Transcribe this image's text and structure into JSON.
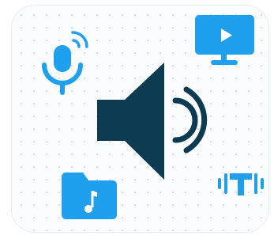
{
  "illustration": {
    "icons": [
      "microphone-icon",
      "monitor-play-icon",
      "speaker-volume-icon",
      "music-folder-icon",
      "text-to-speech-icon"
    ],
    "colors": {
      "primary": "#0d3b52",
      "accent": "#1ea0ee",
      "background": "#fbfcfd",
      "border": "#e9ecef",
      "white": "#ffffff"
    }
  }
}
